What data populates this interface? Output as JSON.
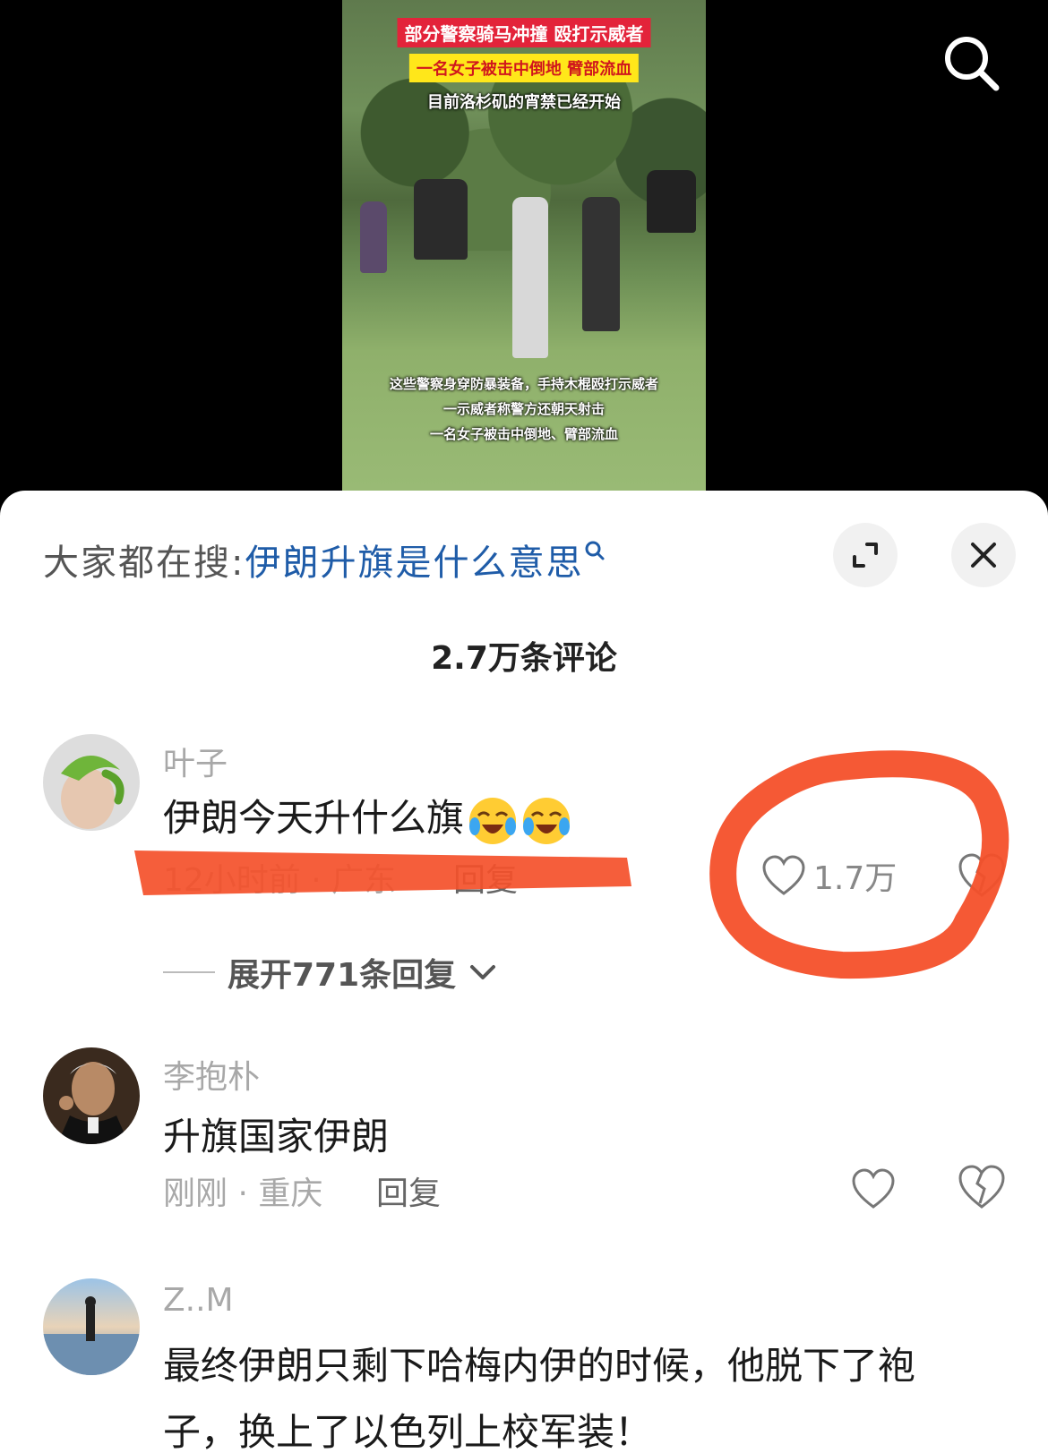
{
  "video": {
    "caption_top": "部分警察骑马冲撞 殴打示威者",
    "caption_highlight": "一名女子被击中倒地 臂部流血",
    "caption_curfew": "目前洛杉矶的宵禁已经开始",
    "subtitle_line1": "这些警察身穿防暴装备，手持木棍殴打示威者",
    "subtitle_line2": "一示威者称警方还朝天射击",
    "subtitle_line3": "一名女子被击中倒地、臂部流血"
  },
  "header": {
    "search_prefix": "大家都在搜:",
    "search_query": "伊朗升旗是什么意思",
    "comment_count": "2.7万条评论"
  },
  "comments": [
    {
      "username": "叶子",
      "content": "伊朗今天升什么旗",
      "time_location": "12小时前 · 广东",
      "reply_label": "回复",
      "like_count": "1.7万",
      "expand_label": "展开771条回复"
    },
    {
      "username": "李抱朴",
      "content": "升旗国家伊朗",
      "time_location": "刚刚 · 重庆",
      "reply_label": "回复"
    },
    {
      "username": "Z..M",
      "content_line1": "最终伊朗只剩下哈梅内伊的时候，他脱下了袍",
      "content_line2": "子，换上了以色列上校军装！"
    }
  ],
  "colors": {
    "annotation_red": "#f4502a",
    "link_blue": "#1f5ca8",
    "caption_red": "#e3233a",
    "caption_yellow": "#ffe71a"
  }
}
